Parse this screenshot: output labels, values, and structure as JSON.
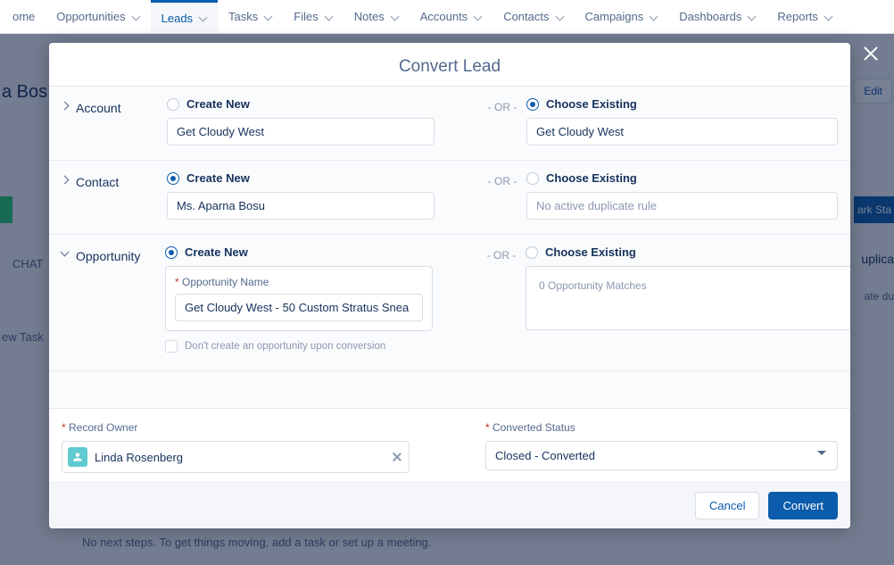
{
  "nav": {
    "items": [
      {
        "label": "ome",
        "hasChevron": false
      },
      {
        "label": "Opportunities",
        "hasChevron": true
      },
      {
        "label": "Leads",
        "hasChevron": true,
        "active": true
      },
      {
        "label": "Tasks",
        "hasChevron": true
      },
      {
        "label": "Files",
        "hasChevron": true
      },
      {
        "label": "Notes",
        "hasChevron": true
      },
      {
        "label": "Accounts",
        "hasChevron": true
      },
      {
        "label": "Contacts",
        "hasChevron": true
      },
      {
        "label": "Campaigns",
        "hasChevron": true
      },
      {
        "label": "Dashboards",
        "hasChevron": true
      },
      {
        "label": "Reports",
        "hasChevron": true
      }
    ]
  },
  "background": {
    "lead_name": "a Bos",
    "edit_label": "Edit",
    "mark_sta": "ark Sta",
    "chat": "CHAT",
    "right1": "uplica",
    "right2": "ate du",
    "new_task": "ew Task",
    "next_steps": "No next steps. To get things moving, add a task or set up a meeting."
  },
  "modal": {
    "title": "Convert Lead",
    "or_label": "- OR -",
    "account": {
      "section": "Account",
      "create_label": "Create New",
      "create_value": "Get Cloudy West",
      "choose_label": "Choose Existing",
      "choose_value": "Get Cloudy West",
      "selected": "choose"
    },
    "contact": {
      "section": "Contact",
      "create_label": "Create New",
      "create_value": "Ms. Aparna Bosu",
      "choose_label": "Choose Existing",
      "choose_placeholder": "No active duplicate rule",
      "selected": "create"
    },
    "opportunity": {
      "section": "Opportunity",
      "create_label": "Create New",
      "opp_name_label": "Opportunity Name",
      "opp_name_value": "Get Cloudy West - 50 Custom Stratus Snea",
      "dont_create_label": "Don't create an opportunity upon conversion",
      "choose_label": "Choose Existing",
      "matches_text": "0 Opportunity Matches",
      "selected": "create"
    },
    "record_owner": {
      "label": "Record Owner",
      "value": "Linda Rosenberg"
    },
    "converted_status": {
      "label": "Converted Status",
      "value": "Closed - Converted"
    },
    "footer": {
      "cancel": "Cancel",
      "convert": "Convert"
    }
  }
}
